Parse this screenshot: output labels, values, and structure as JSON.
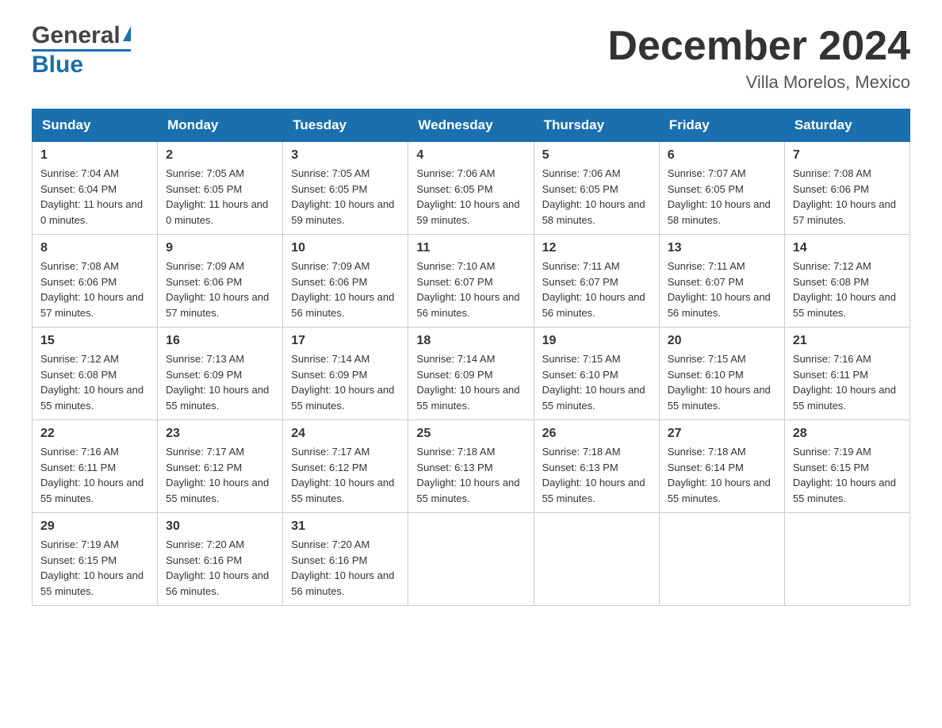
{
  "header": {
    "month_title": "December 2024",
    "location": "Villa Morelos, Mexico",
    "logo_general": "General",
    "logo_blue": "Blue"
  },
  "days_of_week": [
    "Sunday",
    "Monday",
    "Tuesday",
    "Wednesday",
    "Thursday",
    "Friday",
    "Saturday"
  ],
  "weeks": [
    [
      {
        "day": "1",
        "sunrise": "7:04 AM",
        "sunset": "6:04 PM",
        "daylight": "11 hours and 0 minutes."
      },
      {
        "day": "2",
        "sunrise": "7:05 AM",
        "sunset": "6:05 PM",
        "daylight": "11 hours and 0 minutes."
      },
      {
        "day": "3",
        "sunrise": "7:05 AM",
        "sunset": "6:05 PM",
        "daylight": "10 hours and 59 minutes."
      },
      {
        "day": "4",
        "sunrise": "7:06 AM",
        "sunset": "6:05 PM",
        "daylight": "10 hours and 59 minutes."
      },
      {
        "day": "5",
        "sunrise": "7:06 AM",
        "sunset": "6:05 PM",
        "daylight": "10 hours and 58 minutes."
      },
      {
        "day": "6",
        "sunrise": "7:07 AM",
        "sunset": "6:05 PM",
        "daylight": "10 hours and 58 minutes."
      },
      {
        "day": "7",
        "sunrise": "7:08 AM",
        "sunset": "6:06 PM",
        "daylight": "10 hours and 57 minutes."
      }
    ],
    [
      {
        "day": "8",
        "sunrise": "7:08 AM",
        "sunset": "6:06 PM",
        "daylight": "10 hours and 57 minutes."
      },
      {
        "day": "9",
        "sunrise": "7:09 AM",
        "sunset": "6:06 PM",
        "daylight": "10 hours and 57 minutes."
      },
      {
        "day": "10",
        "sunrise": "7:09 AM",
        "sunset": "6:06 PM",
        "daylight": "10 hours and 56 minutes."
      },
      {
        "day": "11",
        "sunrise": "7:10 AM",
        "sunset": "6:07 PM",
        "daylight": "10 hours and 56 minutes."
      },
      {
        "day": "12",
        "sunrise": "7:11 AM",
        "sunset": "6:07 PM",
        "daylight": "10 hours and 56 minutes."
      },
      {
        "day": "13",
        "sunrise": "7:11 AM",
        "sunset": "6:07 PM",
        "daylight": "10 hours and 56 minutes."
      },
      {
        "day": "14",
        "sunrise": "7:12 AM",
        "sunset": "6:08 PM",
        "daylight": "10 hours and 55 minutes."
      }
    ],
    [
      {
        "day": "15",
        "sunrise": "7:12 AM",
        "sunset": "6:08 PM",
        "daylight": "10 hours and 55 minutes."
      },
      {
        "day": "16",
        "sunrise": "7:13 AM",
        "sunset": "6:09 PM",
        "daylight": "10 hours and 55 minutes."
      },
      {
        "day": "17",
        "sunrise": "7:14 AM",
        "sunset": "6:09 PM",
        "daylight": "10 hours and 55 minutes."
      },
      {
        "day": "18",
        "sunrise": "7:14 AM",
        "sunset": "6:09 PM",
        "daylight": "10 hours and 55 minutes."
      },
      {
        "day": "19",
        "sunrise": "7:15 AM",
        "sunset": "6:10 PM",
        "daylight": "10 hours and 55 minutes."
      },
      {
        "day": "20",
        "sunrise": "7:15 AM",
        "sunset": "6:10 PM",
        "daylight": "10 hours and 55 minutes."
      },
      {
        "day": "21",
        "sunrise": "7:16 AM",
        "sunset": "6:11 PM",
        "daylight": "10 hours and 55 minutes."
      }
    ],
    [
      {
        "day": "22",
        "sunrise": "7:16 AM",
        "sunset": "6:11 PM",
        "daylight": "10 hours and 55 minutes."
      },
      {
        "day": "23",
        "sunrise": "7:17 AM",
        "sunset": "6:12 PM",
        "daylight": "10 hours and 55 minutes."
      },
      {
        "day": "24",
        "sunrise": "7:17 AM",
        "sunset": "6:12 PM",
        "daylight": "10 hours and 55 minutes."
      },
      {
        "day": "25",
        "sunrise": "7:18 AM",
        "sunset": "6:13 PM",
        "daylight": "10 hours and 55 minutes."
      },
      {
        "day": "26",
        "sunrise": "7:18 AM",
        "sunset": "6:13 PM",
        "daylight": "10 hours and 55 minutes."
      },
      {
        "day": "27",
        "sunrise": "7:18 AM",
        "sunset": "6:14 PM",
        "daylight": "10 hours and 55 minutes."
      },
      {
        "day": "28",
        "sunrise": "7:19 AM",
        "sunset": "6:15 PM",
        "daylight": "10 hours and 55 minutes."
      }
    ],
    [
      {
        "day": "29",
        "sunrise": "7:19 AM",
        "sunset": "6:15 PM",
        "daylight": "10 hours and 55 minutes."
      },
      {
        "day": "30",
        "sunrise": "7:20 AM",
        "sunset": "6:16 PM",
        "daylight": "10 hours and 56 minutes."
      },
      {
        "day": "31",
        "sunrise": "7:20 AM",
        "sunset": "6:16 PM",
        "daylight": "10 hours and 56 minutes."
      },
      null,
      null,
      null,
      null
    ]
  ],
  "labels": {
    "sunrise": "Sunrise:",
    "sunset": "Sunset:",
    "daylight": "Daylight:"
  }
}
